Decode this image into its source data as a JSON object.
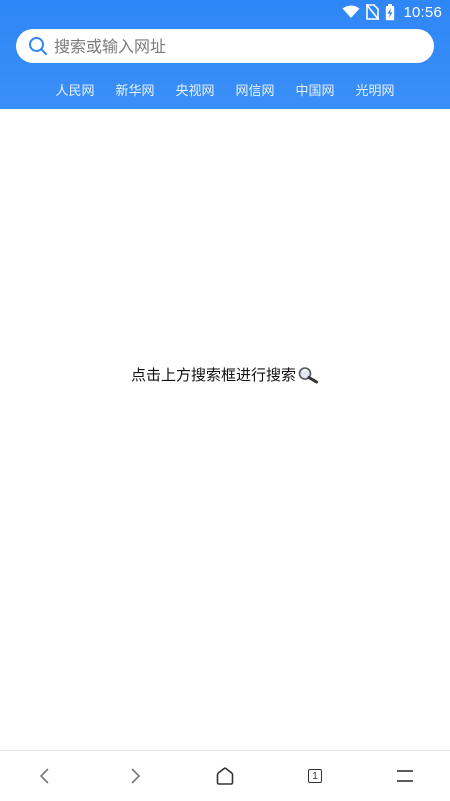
{
  "status_bar": {
    "time": "10:56",
    "icons": [
      "wifi-icon",
      "no-sim-icon",
      "battery-charging-icon"
    ]
  },
  "search": {
    "placeholder": "搜索或输入网址",
    "value": "",
    "icon": "search-icon"
  },
  "site_links": [
    {
      "label": "人民网"
    },
    {
      "label": "新华网"
    },
    {
      "label": "央视网"
    },
    {
      "label": "网信网"
    },
    {
      "label": "中国网"
    },
    {
      "label": "光明网"
    }
  ],
  "main": {
    "hint": "点击上方搜索框进行搜索",
    "hint_icon": "magnifier-icon"
  },
  "bottom_nav": {
    "tab_count": "1",
    "items": [
      "back-icon",
      "forward-icon",
      "home-icon",
      "tabs-icon",
      "menu-icon"
    ]
  },
  "colors": {
    "header": "#3a8ff7",
    "search_icon": "#2f86f6"
  }
}
